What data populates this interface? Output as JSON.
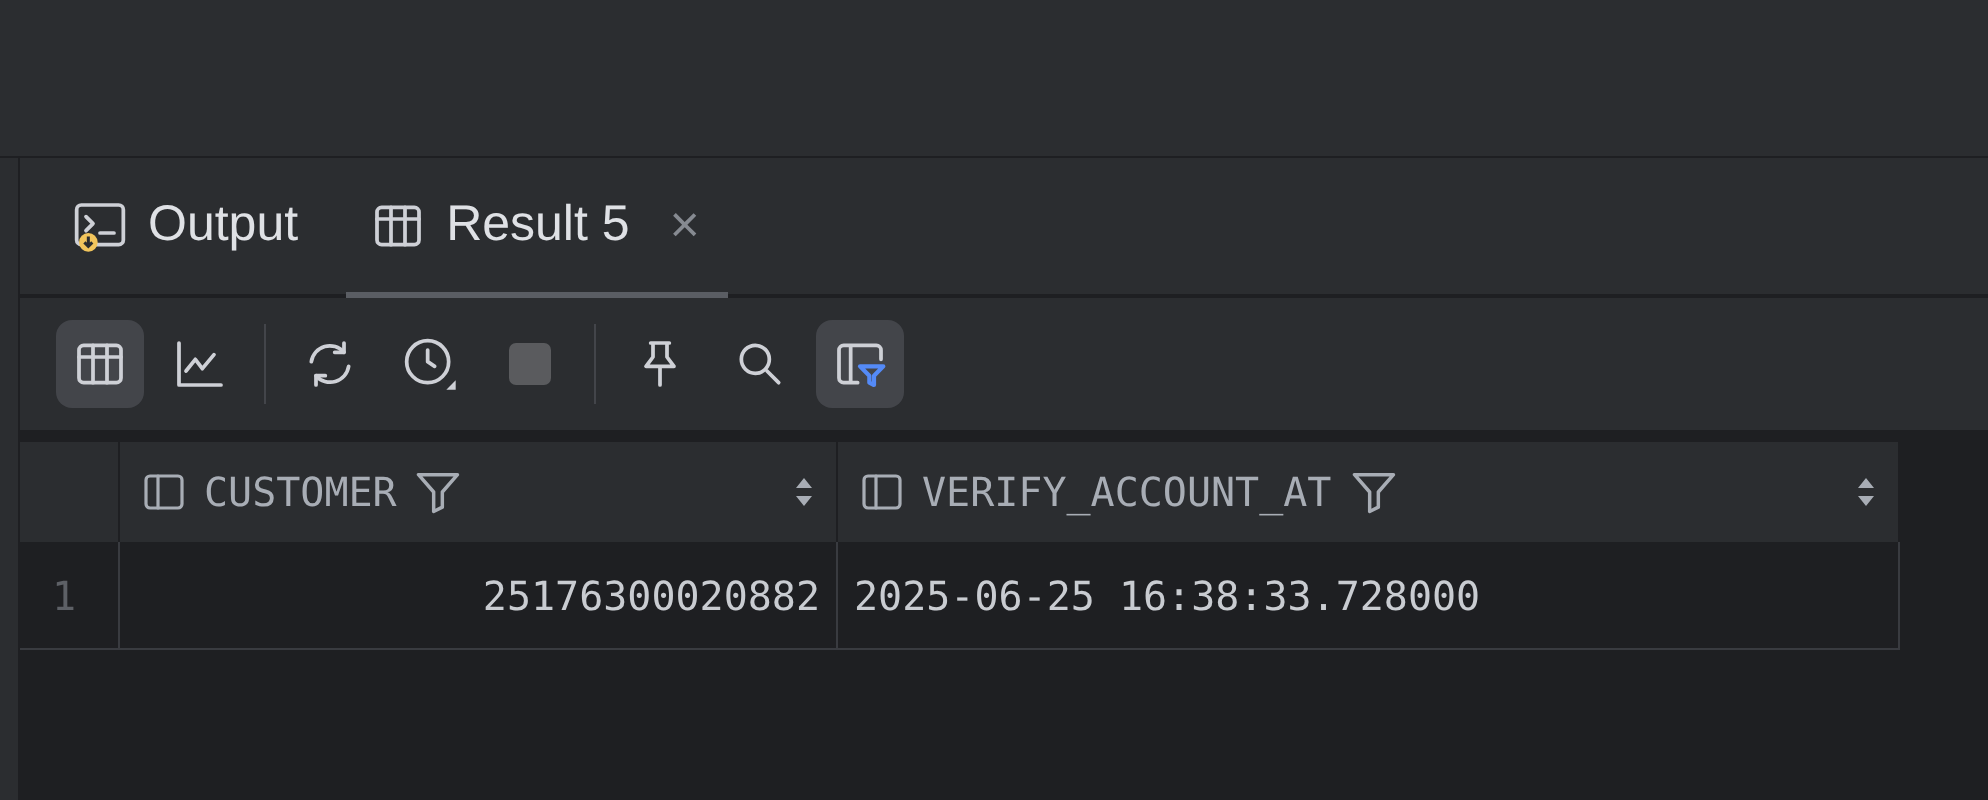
{
  "tabs": [
    {
      "kind": "console",
      "label": "Output",
      "selected": false
    },
    {
      "kind": "table",
      "label": "Result 5",
      "selected": true,
      "close": "×"
    }
  ],
  "toolbar": [
    {
      "kind": "table",
      "selected": true
    },
    {
      "kind": "chart",
      "selected": false
    },
    {
      "kind": "sep"
    },
    {
      "kind": "refresh",
      "selected": false
    },
    {
      "kind": "history",
      "selected": false
    },
    {
      "kind": "stop",
      "selected": false
    },
    {
      "kind": "sep"
    },
    {
      "kind": "pin",
      "selected": false
    },
    {
      "kind": "search",
      "selected": false
    },
    {
      "kind": "filter",
      "selected": true
    }
  ],
  "table": {
    "columns": [
      "CUSTOMER",
      "VERIFY_ACCOUNT_AT"
    ],
    "rows": [
      {
        "number": "1",
        "cells": [
          "25176300020882",
          "2025-06-25 16:38:33.728000"
        ]
      }
    ]
  }
}
